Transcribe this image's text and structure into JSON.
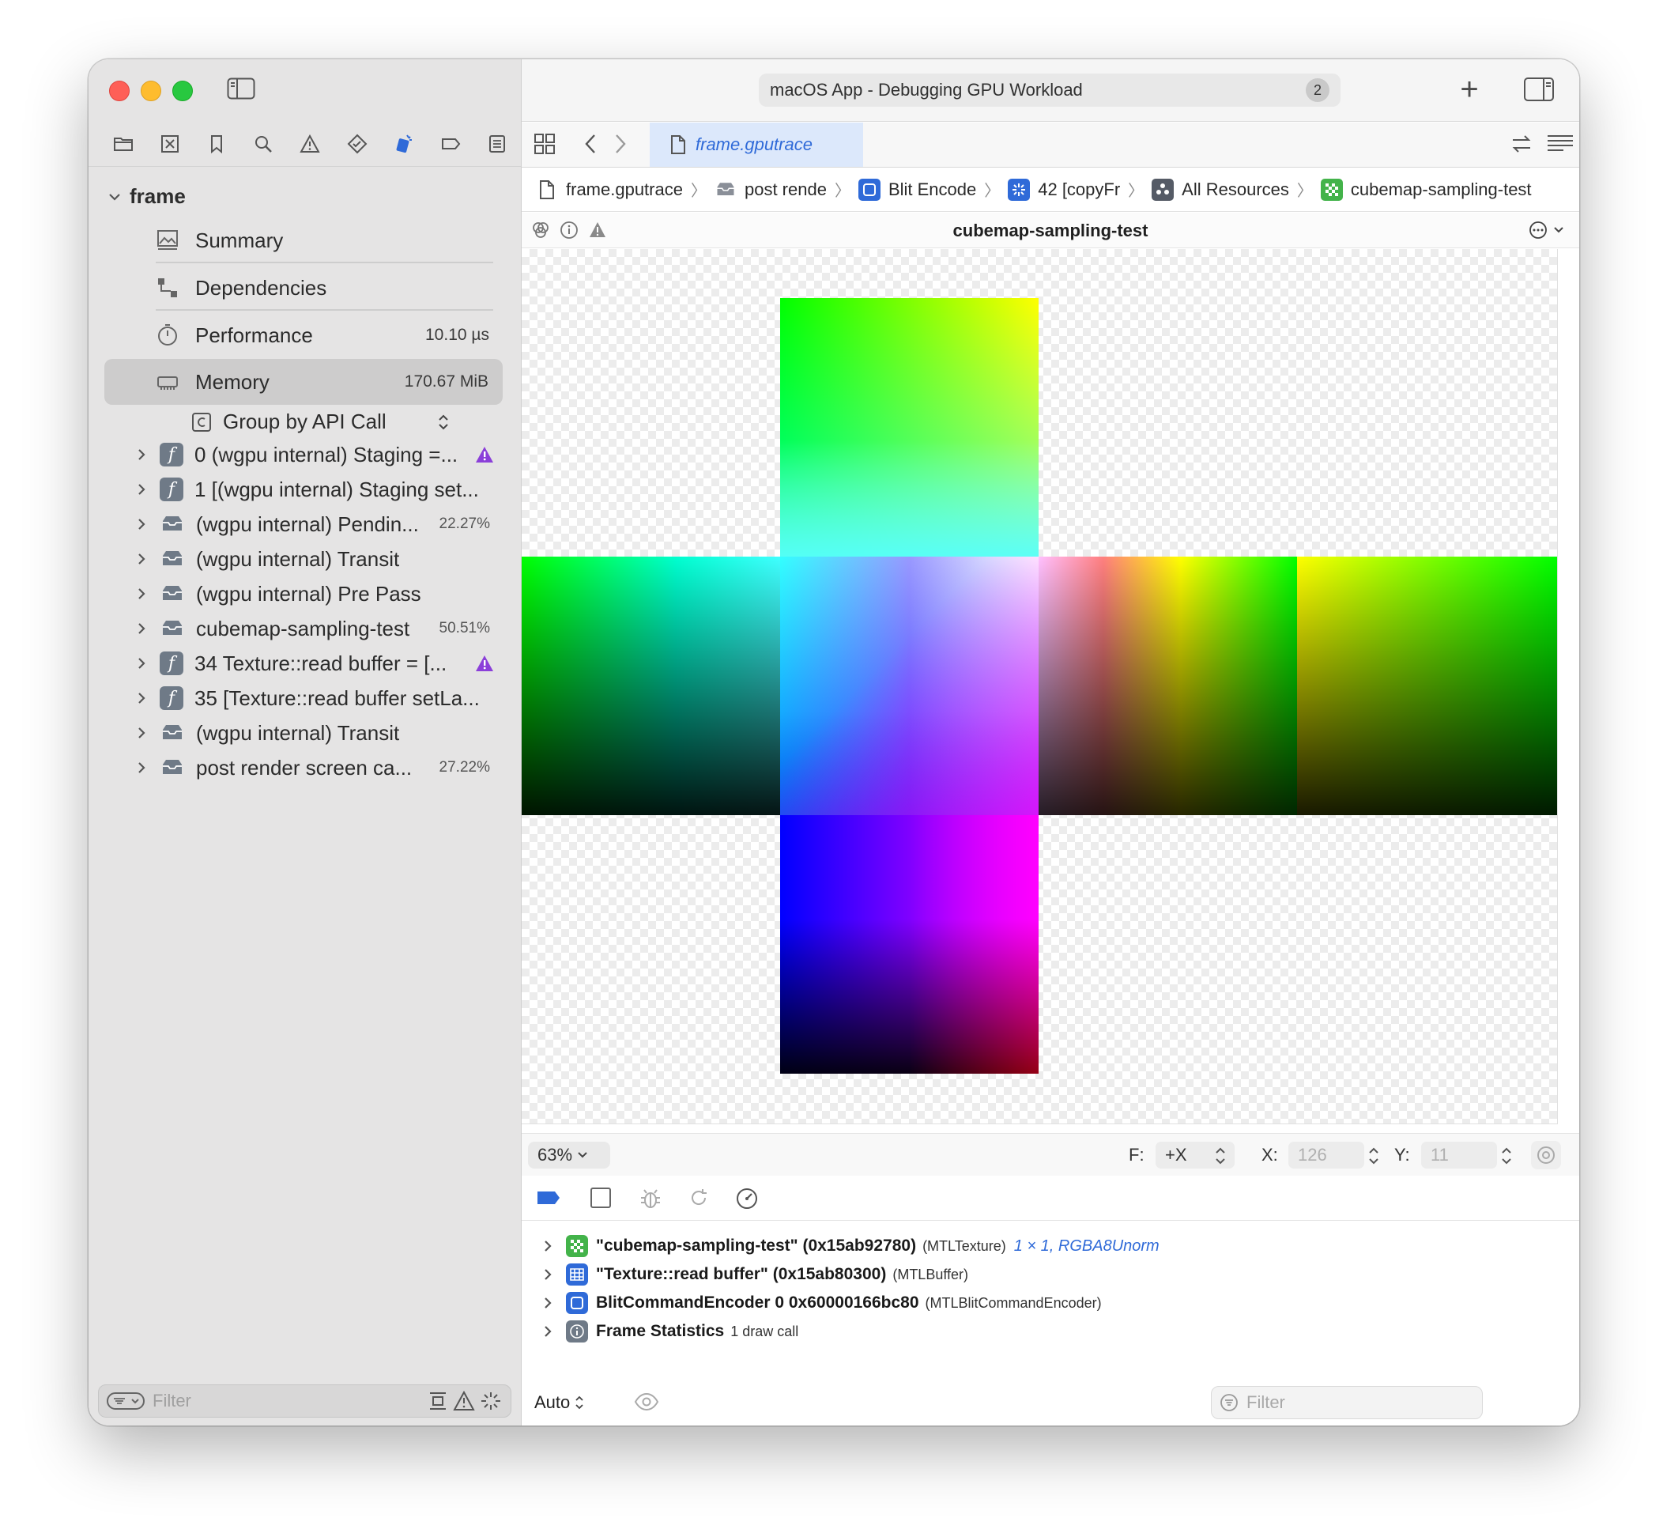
{
  "window": {
    "title": "macOS App - Debugging GPU Workload",
    "activity_count": "2"
  },
  "sidebar": {
    "root": "frame",
    "nav": [
      {
        "label": "Summary",
        "value": ""
      },
      {
        "label": "Dependencies",
        "value": ""
      },
      {
        "label": "Performance",
        "value": "10.10 µs"
      },
      {
        "label": "Memory",
        "value": "170.67 MiB"
      }
    ],
    "group_by": "Group by API Call",
    "calls": [
      {
        "label": "0 (wgpu internal) Staging =...",
        "pct": "",
        "icon": "function-icon",
        "warn": true
      },
      {
        "label": "1 [(wgpu internal) Staging set...",
        "pct": "",
        "icon": "function-icon",
        "warn": false
      },
      {
        "label": "(wgpu internal) Pendin...",
        "pct": "22.27%",
        "icon": "tray-icon",
        "warn": false
      },
      {
        "label": "(wgpu internal) Transit",
        "pct": "",
        "icon": "tray-icon",
        "warn": false
      },
      {
        "label": "(wgpu internal) Pre Pass",
        "pct": "",
        "icon": "tray-icon",
        "warn": false
      },
      {
        "label": "cubemap-sampling-test",
        "pct": "50.51%",
        "icon": "tray-icon",
        "warn": false
      },
      {
        "label": "34 Texture::read buffer = [...",
        "pct": "",
        "icon": "function-icon",
        "warn": true
      },
      {
        "label": "35 [Texture::read buffer setLa...",
        "pct": "",
        "icon": "function-icon",
        "warn": false
      },
      {
        "label": "(wgpu internal) Transit",
        "pct": "",
        "icon": "tray-icon",
        "warn": false
      },
      {
        "label": "post render screen ca...",
        "pct": "27.22%",
        "icon": "tray-icon",
        "warn": false
      }
    ],
    "filter_placeholder": "Filter"
  },
  "tab": {
    "label": "frame.gputrace"
  },
  "breadcrumbs": [
    {
      "label": "frame.gputrace",
      "icon": "document-icon",
      "color": ""
    },
    {
      "label": "post rende",
      "icon": "tray-icon",
      "color": ""
    },
    {
      "label": "Blit Encode",
      "icon": "blit-encoder-icon",
      "color": "#2f6ad8"
    },
    {
      "label": "42 [copyFr",
      "icon": "copy-command-icon",
      "color": "#2f6ad8"
    },
    {
      "label": "All Resources",
      "icon": "resources-icon",
      "color": "#555b66"
    },
    {
      "label": "cubemap-sampling-test",
      "icon": "texture-icon",
      "color": "#43b34a"
    }
  ],
  "viewer": {
    "title": "cubemap-sampling-test",
    "zoom": "63%",
    "face_label": "F:",
    "face_value": "+X",
    "x_label": "X:",
    "x_value": "126",
    "y_label": "Y:",
    "y_value": "11"
  },
  "variables": [
    {
      "name": "\"cubemap-sampling-test\" (0x15ab92780)",
      "type": "(MTLTexture)",
      "info": "1 × 1, RGBA8Unorm",
      "icon": "texture-icon",
      "color": "#43b34a"
    },
    {
      "name": "\"Texture::read buffer\" (0x15ab80300)",
      "type": "(MTLBuffer)",
      "info": "",
      "icon": "buffer-icon",
      "color": "#2f6ad8"
    },
    {
      "name": "BlitCommandEncoder 0 0x60000166bc80",
      "type": "(MTLBlitCommandEncoder)",
      "info": "",
      "icon": "blit-encoder-icon",
      "color": "#2f6ad8"
    },
    {
      "name": "Frame Statistics",
      "type": "1 draw call",
      "info": "",
      "icon": "info-icon",
      "color": "#6f7a87"
    }
  ],
  "bottom": {
    "auto_label": "Auto",
    "filter_placeholder": "Filter"
  }
}
